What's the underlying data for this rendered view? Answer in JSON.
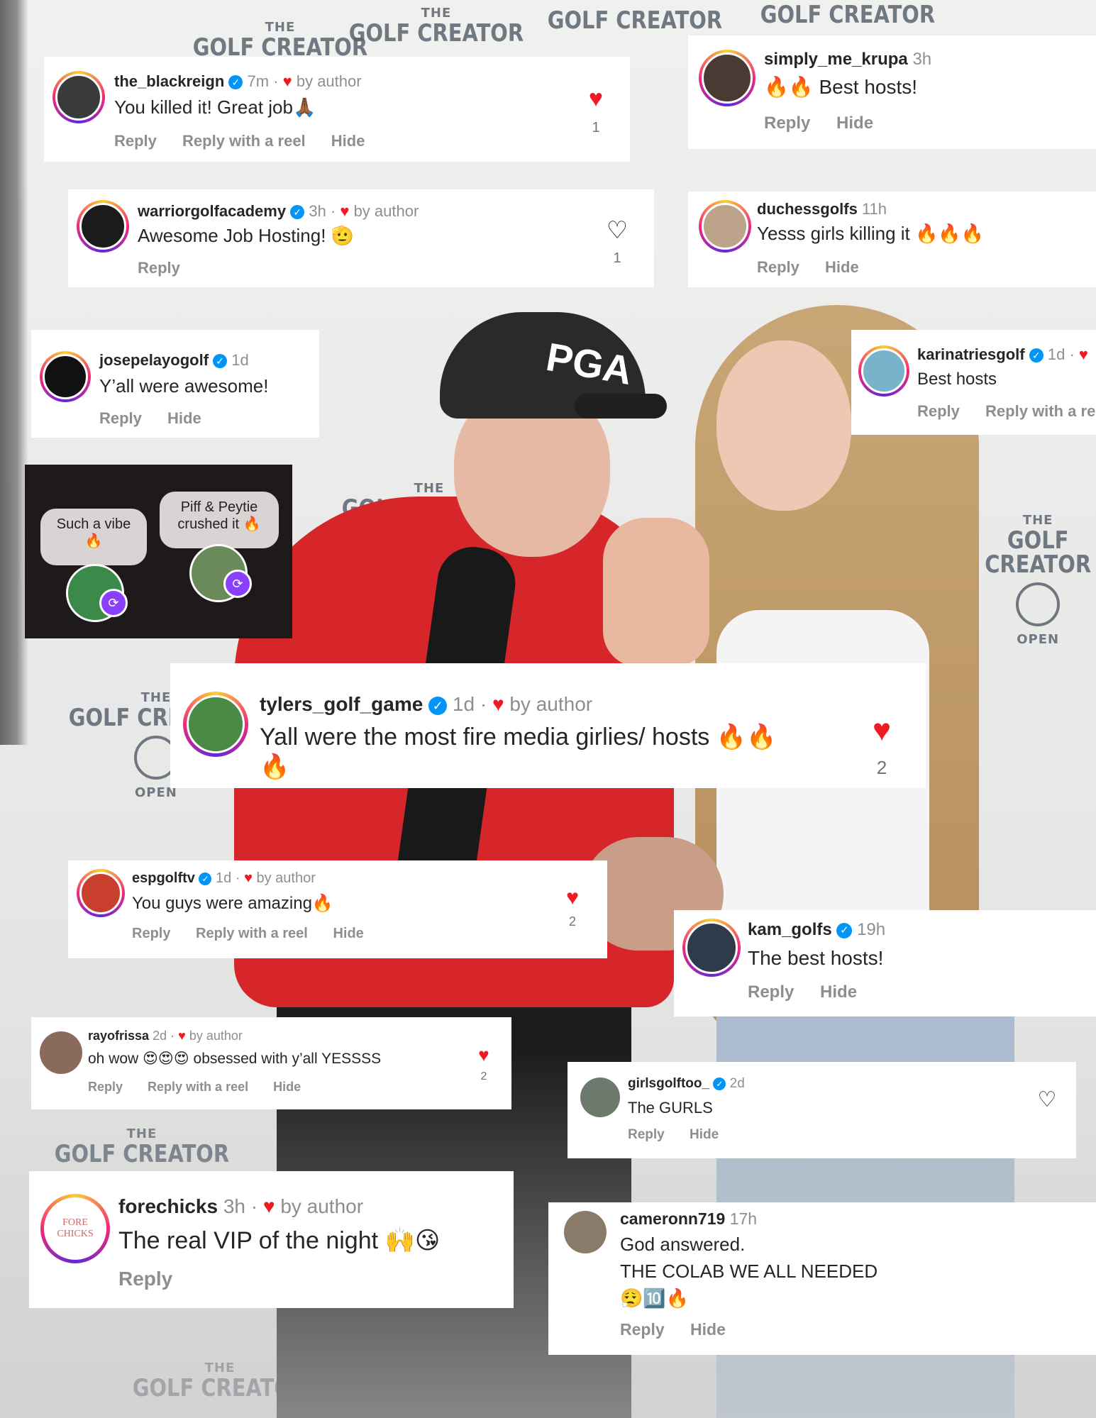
{
  "comments": [
    {
      "username": "the_blackreign",
      "time": "7m",
      "by_author": "by author",
      "text": "You killed it! Great job🙏🏾",
      "actions": [
        "Reply",
        "Reply with a reel",
        "Hide"
      ],
      "likes": "1"
    },
    {
      "username": "simply_me_krupa",
      "time": "3h",
      "text": "🔥🔥 Best hosts!",
      "actions": [
        "Reply",
        "Hide"
      ]
    },
    {
      "username": "warriorgolfacademy",
      "time": "3h",
      "by_author": "by author",
      "text": "Awesome Job Hosting! 🫡",
      "actions": [
        "Reply"
      ],
      "likes": "1"
    },
    {
      "username": "duchessgolfs",
      "time": "11h",
      "text": "Yesss girls killing it 🔥🔥🔥",
      "actions": [
        "Reply",
        "Hide"
      ]
    },
    {
      "username": "josepelayogolf",
      "time": "1d",
      "text": "Y’all were awesome!",
      "actions": [
        "Reply",
        "Hide"
      ]
    },
    {
      "username": "karinatriesgolf",
      "time": "1d",
      "text": "Best hosts",
      "actions": [
        "Reply",
        "Reply with a ree"
      ]
    },
    {
      "username": "tylers_golf_game",
      "time": "1d",
      "by_author": "by author",
      "text": "Yall were the most fire media girlies/ hosts 🔥🔥",
      "text2": "🔥",
      "likes": "2"
    },
    {
      "username": "espgolftv",
      "time": "1d",
      "by_author": "by author",
      "text": "You guys were amazing🔥",
      "actions": [
        "Reply",
        "Reply with a reel",
        "Hide"
      ],
      "likes": "2"
    },
    {
      "username": "kam_golfs",
      "time": "19h",
      "text": "The best hosts!",
      "actions": [
        "Reply",
        "Hide"
      ]
    },
    {
      "username": "rayofrissa",
      "time": "2d",
      "by_author": "by author",
      "text": "oh wow 😍😍😍 obsessed with y’all YESSSS",
      "actions": [
        "Reply",
        "Reply with a reel",
        "Hide"
      ],
      "likes": "2"
    },
    {
      "username": "girlsgolftoo_",
      "time": "2d",
      "text": "The GURLS",
      "actions": [
        "Reply",
        "Hide"
      ]
    },
    {
      "username": "forechicks",
      "time": "3h",
      "by_author": "by author",
      "text": "The real VIP of the night 🙌😘",
      "actions": [
        "Reply"
      ],
      "avatar_text": "FORE CHICKS"
    },
    {
      "username": "cameronn719",
      "time": "17h",
      "text": "God answered.",
      "text2": "THE COLAB WE ALL NEEDED",
      "text3": "😮‍💨🔟🔥",
      "actions": [
        "Reply",
        "Hide"
      ]
    }
  ],
  "snippet": {
    "bubble1": "Such a vibe 🔥",
    "bubble2_line1": "Piff & Peytie",
    "bubble2_line2": "crushed it 🔥"
  },
  "background": {
    "logo_small": "THE",
    "logo_big": "GOLF CREATOR",
    "logo_open": "OPEN",
    "cap_text": "PGA"
  },
  "colors": {
    "heart": "#ed1c24",
    "verified": "#0095f6",
    "shirt": "#d7262a"
  },
  "icons": {
    "liked": "heart-filled-icon",
    "unliked": "heart-outline-icon",
    "verified": "verified-badge-icon",
    "repost": "repost-icon"
  }
}
